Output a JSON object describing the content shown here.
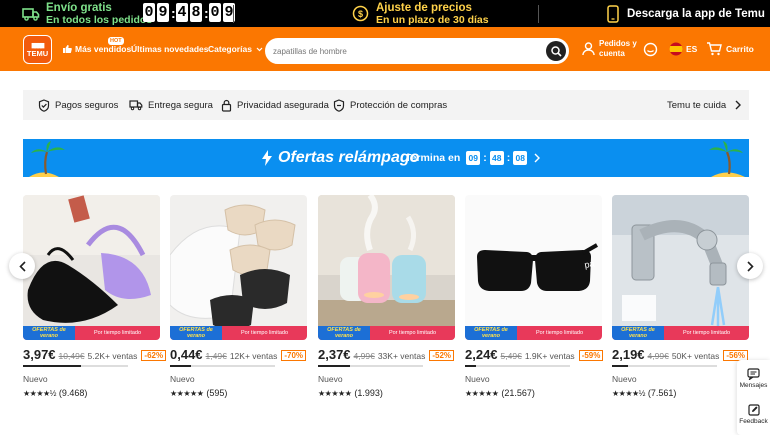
{
  "promo": {
    "shipping_line1": "Envío gratis",
    "shipping_line2": "En todos los pedidos",
    "countdown": [
      "0",
      "9",
      ":",
      "4",
      "8",
      ":",
      "0",
      "9"
    ],
    "price_line1": "Ajuste de precios",
    "price_line2": "En un plazo de 30 días",
    "app_text": "Descarga la app de Temu"
  },
  "header": {
    "logo_top": "▇▇▇▇",
    "logo_text": "TEMU",
    "best_sellers": "Más vendidos",
    "hot_badge": "HOT",
    "new_arrivals": "Últimas novedades",
    "categories": "Categorías",
    "search_placeholder": "zapatillas de hombre",
    "orders_line1": "Pedidos y",
    "orders_line2": "cuenta",
    "language": "ES",
    "cart": "Carrito"
  },
  "trust": {
    "items": [
      "Pagos seguros",
      "Entrega segura",
      "Privacidad asegurada",
      "Protección de compras"
    ],
    "cares": "Temu te cuida"
  },
  "flash": {
    "title": "Ofertas relámpago",
    "ends_label": "Termina en",
    "hours": "09",
    "minutes": "48",
    "seconds": "08"
  },
  "products": [
    {
      "price": "3,97€",
      "old": "10,49€",
      "sold": "5.2K+ ventas",
      "discount": "-62%",
      "status": "Nuevo",
      "reviews": "(9.468)",
      "stars": "★★★★½",
      "tag_left": "OFERTAS de verano",
      "tag_right": "Por tiempo limitado",
      "progress": 0.55
    },
    {
      "price": "0,44€",
      "old": "1,49€",
      "sold": "12K+ ventas",
      "discount": "-70%",
      "status": "Nuevo",
      "reviews": "(595)",
      "stars": "★★★★★",
      "tag_left": "OFERTAS de verano",
      "tag_right": "Por tiempo limitado",
      "progress": 0.2
    },
    {
      "price": "2,37€",
      "old": "4,99€",
      "sold": "33K+ ventas",
      "discount": "-52%",
      "status": "Nuevo",
      "reviews": "(1.993)",
      "stars": "★★★★★",
      "tag_left": "OFERTAS de verano",
      "tag_right": "Por tiempo limitado",
      "progress": 0.3
    },
    {
      "price": "2,24€",
      "old": "5,49€",
      "sold": "1.9K+ ventas",
      "discount": "-59%",
      "status": "Nuevo",
      "reviews": "(21.567)",
      "stars": "★★★★★",
      "tag_left": "OFERTAS de verano",
      "tag_right": "Por tiempo limitado",
      "progress": 0.1
    },
    {
      "price": "2,19€",
      "old": "4,99€",
      "sold": "50K+ ventas",
      "discount": "-56%",
      "status": "Nuevo",
      "reviews": "(7.561)",
      "stars": "★★★★½",
      "tag_left": "OFERTAS de verano",
      "tag_right": "Por tiempo limitado",
      "progress": 0.15
    }
  ],
  "side": {
    "messages": "Mensajes",
    "feedback": "Feedback"
  },
  "colors": {
    "brand_orange": "#fb7701",
    "flash_blue": "#0a8ff0",
    "promo_green": "#7ee08a",
    "promo_yellow": "#ffd24a"
  }
}
